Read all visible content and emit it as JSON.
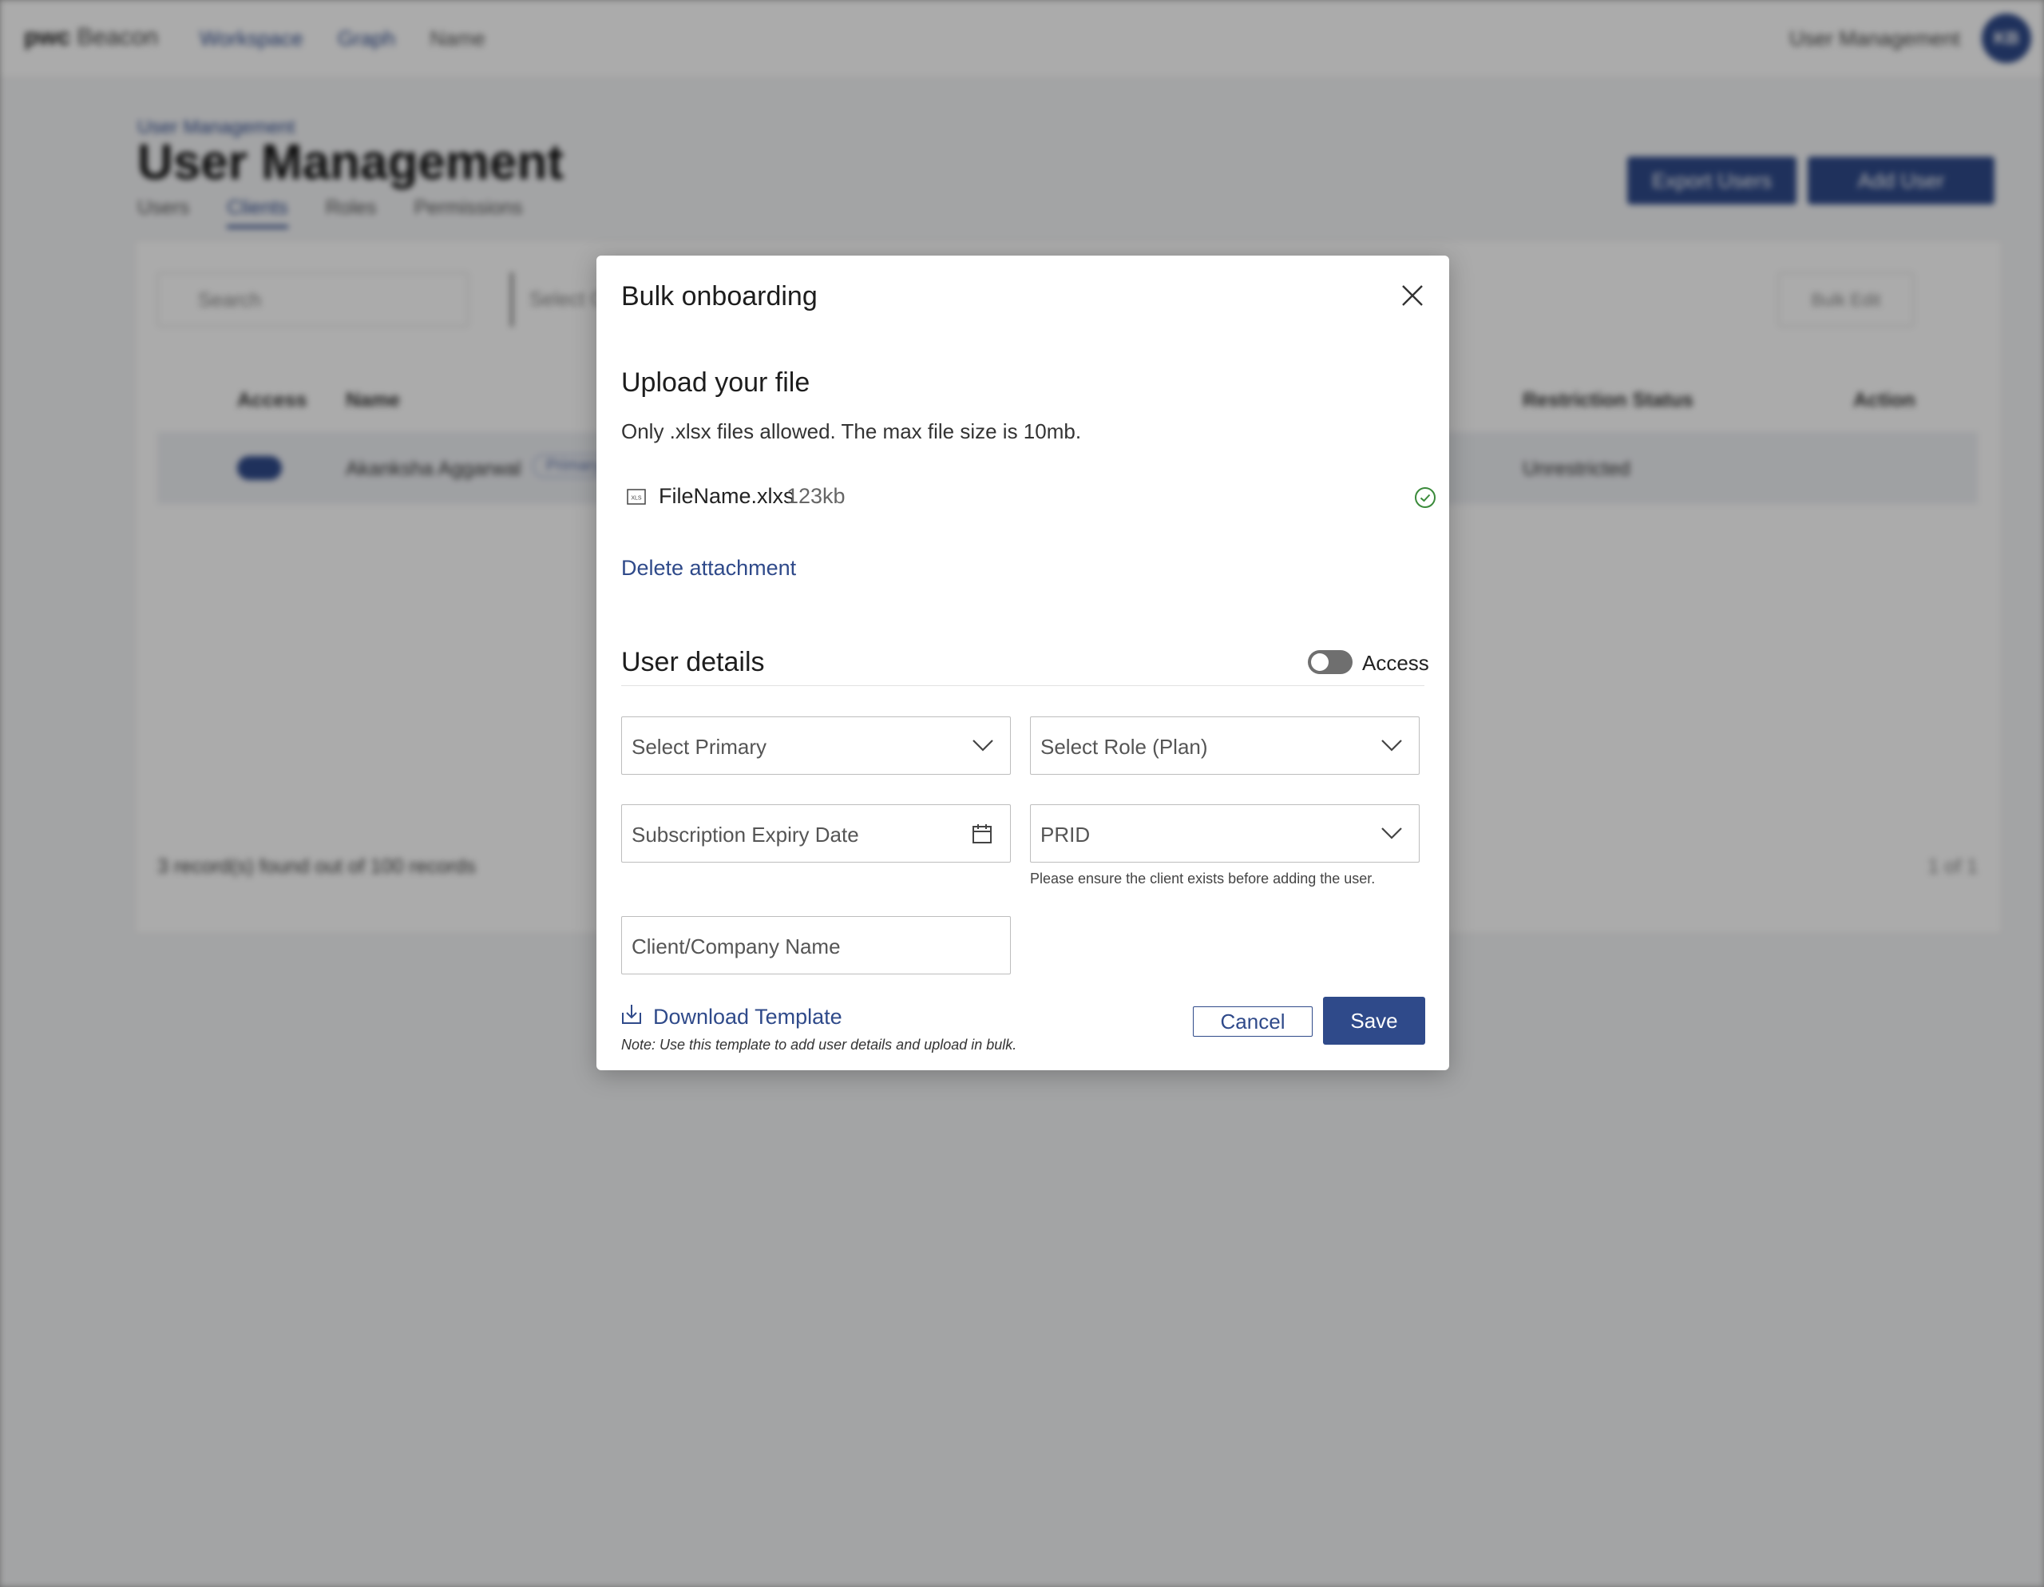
{
  "background": {
    "app": {
      "logo": "pwc",
      "product": "Beacon"
    },
    "breadcrumbs": [
      "Workspace",
      "Graph",
      "Name"
    ],
    "top_right_label": "User Management",
    "avatar_initials": "KB",
    "page_crumb": "User Management",
    "page_title": "User Management",
    "tabs": [
      "Users",
      "Clients",
      "Roles",
      "Permissions"
    ],
    "active_tab": "Clients",
    "export_button": "Export Users",
    "add_user_button": "Add User",
    "search_placeholder": "Search",
    "filter_select": "Select Cl",
    "bulk_button": "Bulk Edit",
    "table_headers": [
      "Access",
      "Name",
      "Restriction Status",
      "Action"
    ],
    "row": {
      "name": "Akanksha Aggarwal",
      "badge": "Primary",
      "restriction": "Unrestricted"
    },
    "records_text": "3 record(s) found out of 100 records",
    "pager": "1  of 1"
  },
  "modal": {
    "title": "Bulk onboarding",
    "upload_section_title": "Upload your file",
    "upload_help": "Only .xlsx files allowed. The max file size is 10mb.",
    "file": {
      "name": "FileName.xlxs",
      "size": "123kb",
      "type_label": "XLS"
    },
    "delete_link": "Delete attachment",
    "user_details_title": "User details",
    "access_label": "Access",
    "fields": {
      "primary": "Select Primary",
      "role": "Select Role (Plan)",
      "expiry": "Subscription Expiry Date",
      "prid": "PRID",
      "company": "Client/Company Name"
    },
    "prid_hint": "Please ensure the client exists before adding the user.",
    "download_template": "Download Template",
    "download_note": "Note: Use this template to add user details and upload in bulk.",
    "cancel_button": "Cancel",
    "save_button": "Save"
  },
  "colors": {
    "accent": "#2f4a8a",
    "success": "#3a8a3a",
    "toggle_off": "#6f6f6f"
  }
}
